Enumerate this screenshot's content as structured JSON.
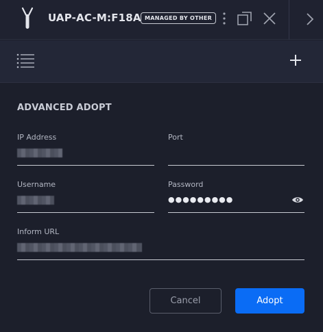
{
  "header": {
    "device_name": "UAP-AC-M:F18A",
    "badge": "MANAGED BY OTHER"
  },
  "icons": {
    "device": "antenna-device-icon",
    "more": "vertical-ellipsis-icon",
    "popout": "popout-window-icon",
    "close": "close-icon",
    "collapse": "chevron-right-icon",
    "list": "list-icon",
    "add": "plus-icon",
    "reveal": "eye-icon"
  },
  "form": {
    "title": "ADVANCED ADOPT",
    "fields": {
      "ip_address": {
        "label": "IP Address",
        "value": ""
      },
      "port": {
        "label": "Port",
        "value": ""
      },
      "username": {
        "label": "Username",
        "value": ""
      },
      "password": {
        "label": "Password",
        "value": "●●●●●●●●●"
      },
      "inform_url": {
        "label": "Inform URL",
        "value": ""
      }
    }
  },
  "buttons": {
    "cancel": "Cancel",
    "adopt": "Adopt"
  },
  "colors": {
    "background": "#1c1f2b",
    "accent": "#0a6cf5"
  }
}
